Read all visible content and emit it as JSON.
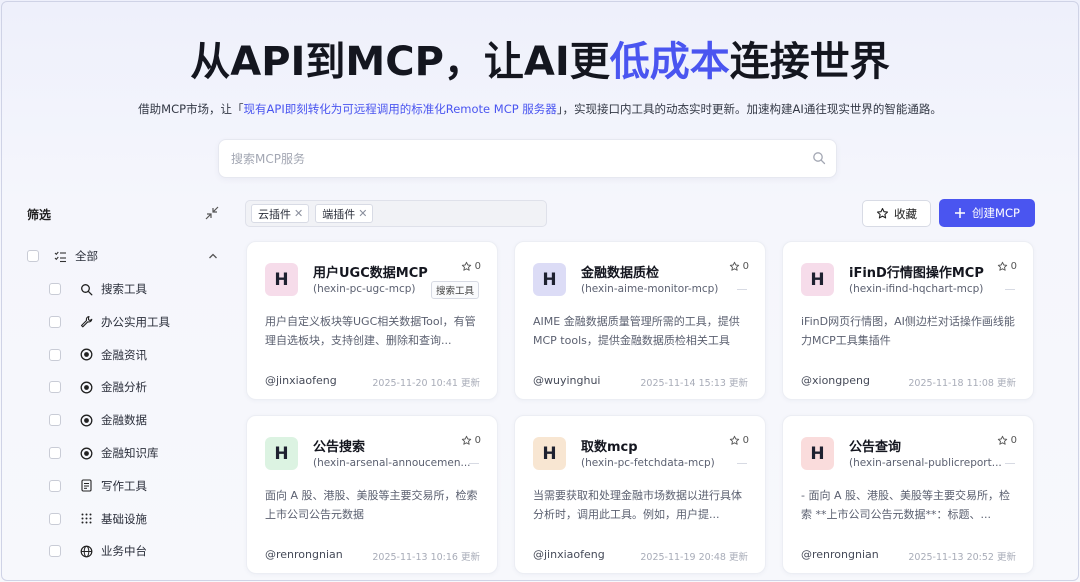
{
  "hero": {
    "title_a": "从API到MCP，让AI更",
    "title_hl": "低成本",
    "title_b": "连接世界",
    "sub_a": "借助MCP市场，让「",
    "sub_hl": "现有API即刻转化为可远程调用的标准化Remote MCP 服务器",
    "sub_b": "」，实现接口内工具的动态实时更新。加速构建AI通往现实世界的智能通路。"
  },
  "search": {
    "placeholder": "搜索MCP服务"
  },
  "sidebar": {
    "title": "筛选",
    "all_label": "全部",
    "items": [
      {
        "label": "搜索工具",
        "icon": "search-icon"
      },
      {
        "label": "办公实用工具",
        "icon": "wrench-icon"
      },
      {
        "label": "金融资讯",
        "icon": "target-icon"
      },
      {
        "label": "金融分析",
        "icon": "target-icon"
      },
      {
        "label": "金融数据",
        "icon": "target-icon"
      },
      {
        "label": "金融知识库",
        "icon": "target-icon"
      },
      {
        "label": "写作工具",
        "icon": "document-icon"
      },
      {
        "label": "基础设施",
        "icon": "grid-icon"
      },
      {
        "label": "业务中台",
        "icon": "globe-icon"
      }
    ]
  },
  "toolbar": {
    "chips": [
      "云插件",
      "端插件"
    ],
    "fav_label": "收藏",
    "create_label": "创建MCP",
    "accent": "#4a55f0"
  },
  "cards": [
    {
      "avatar": "H",
      "avatar_bg": "#f6dcea",
      "title": "用户UGC数据MCP",
      "sub": "(hexin-pc-ugc-mcp)",
      "tag": "搜索工具",
      "stars": "0",
      "desc": "用户自定义板块等UGC相关数据Tool，有管理自选板块，支持创建、删除和查询...",
      "author": "@jinxiaofeng",
      "time": "2025-11-20 10:41 更新"
    },
    {
      "avatar": "H",
      "avatar_bg": "#dcdcf6",
      "title": "金融数据质检",
      "sub": "(hexin-aime-monitor-mcp)",
      "tag": "",
      "stars": "0",
      "desc": "AIME 金融数据质量管理所需的工具，提供 MCP tools，提供金融数据质检相关工具",
      "author": "@wuyinghui",
      "time": "2025-11-14 15:13 更新"
    },
    {
      "avatar": "H",
      "avatar_bg": "#f6dcea",
      "title": "iFinD行情图操作MCP",
      "sub": "(hexin-ifind-hqchart-mcp)",
      "tag": "",
      "stars": "0",
      "desc": "iFinD网页行情图，AI侧边栏对话操作画线能力MCP工具集插件",
      "author": "@xiongpeng",
      "time": "2025-11-18 11:08 更新"
    },
    {
      "avatar": "H",
      "avatar_bg": "#dcf3e2",
      "title": "公告搜索",
      "sub": "(hexin-arsenal-annoucemen...",
      "tag": "",
      "stars": "0",
      "desc": "面向 A 股、港股、美股等主要交易所，检索上市公司公告元数据",
      "author": "@renrongnian",
      "time": "2025-11-13 10:16 更新"
    },
    {
      "avatar": "H",
      "avatar_bg": "#f8e6d2",
      "title": "取数mcp",
      "sub": "(hexin-pc-fetchdata-mcp)",
      "tag": "",
      "stars": "0",
      "desc": "当需要获取和处理金融市场数据以进行具体分析时，调用此工具。例如，用户提...",
      "author": "@jinxiaofeng",
      "time": "2025-11-19 20:48 更新"
    },
    {
      "avatar": "H",
      "avatar_bg": "#fadcdc",
      "title": "公告查询",
      "sub": "(hexin-arsenal-publicreport...",
      "tag": "",
      "stars": "0",
      "desc": "- 面向 A 股、港股、美股等主要交易所，检索 **上市公司公告元数据**：标题、...",
      "author": "@renrongnian",
      "time": "2025-11-13 20:52 更新"
    }
  ]
}
